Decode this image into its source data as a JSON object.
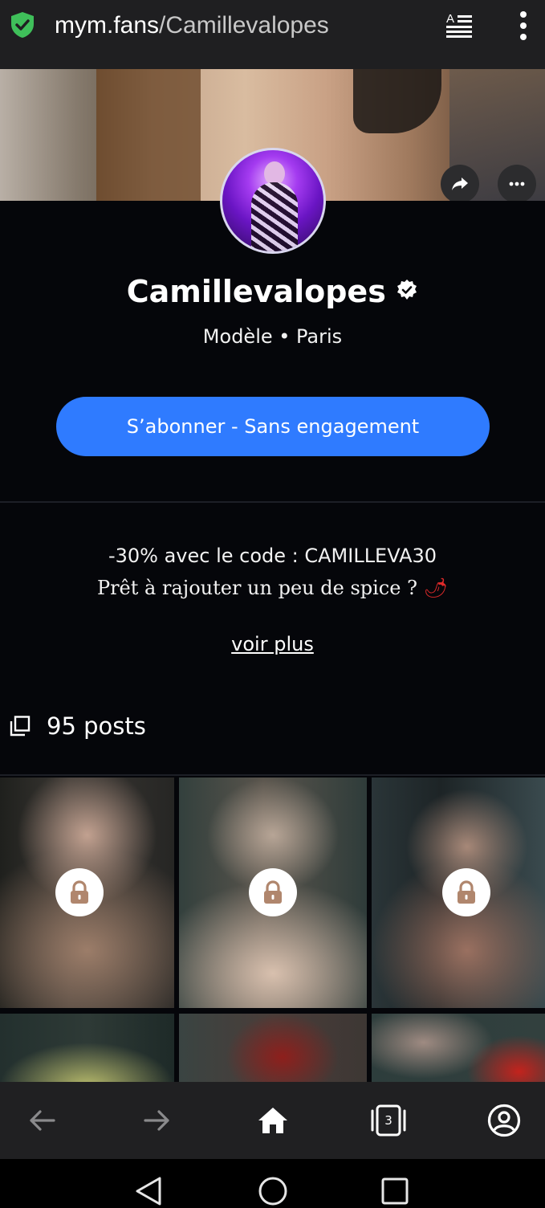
{
  "browser": {
    "url_domain": "mym.fans",
    "url_path": "/Camillevalopes",
    "colors": {
      "bar": "#1f1f21",
      "shield": "#3fbf5a"
    }
  },
  "profile": {
    "name": "Camillevalopes",
    "subtitle": "Modèle • Paris",
    "subscribe_label": "S’abonner - Sans engagement",
    "accent": "#2f7bff"
  },
  "bio": {
    "line1": "-30% avec le code : CAMILLEVA30",
    "line2": "Prêt à rajouter un peu de spice ?",
    "line2_emoji": "🌶",
    "see_more": "voir plus"
  },
  "posts": {
    "count_label": "95 posts"
  },
  "toolbar": {
    "tabs_count": "3"
  }
}
